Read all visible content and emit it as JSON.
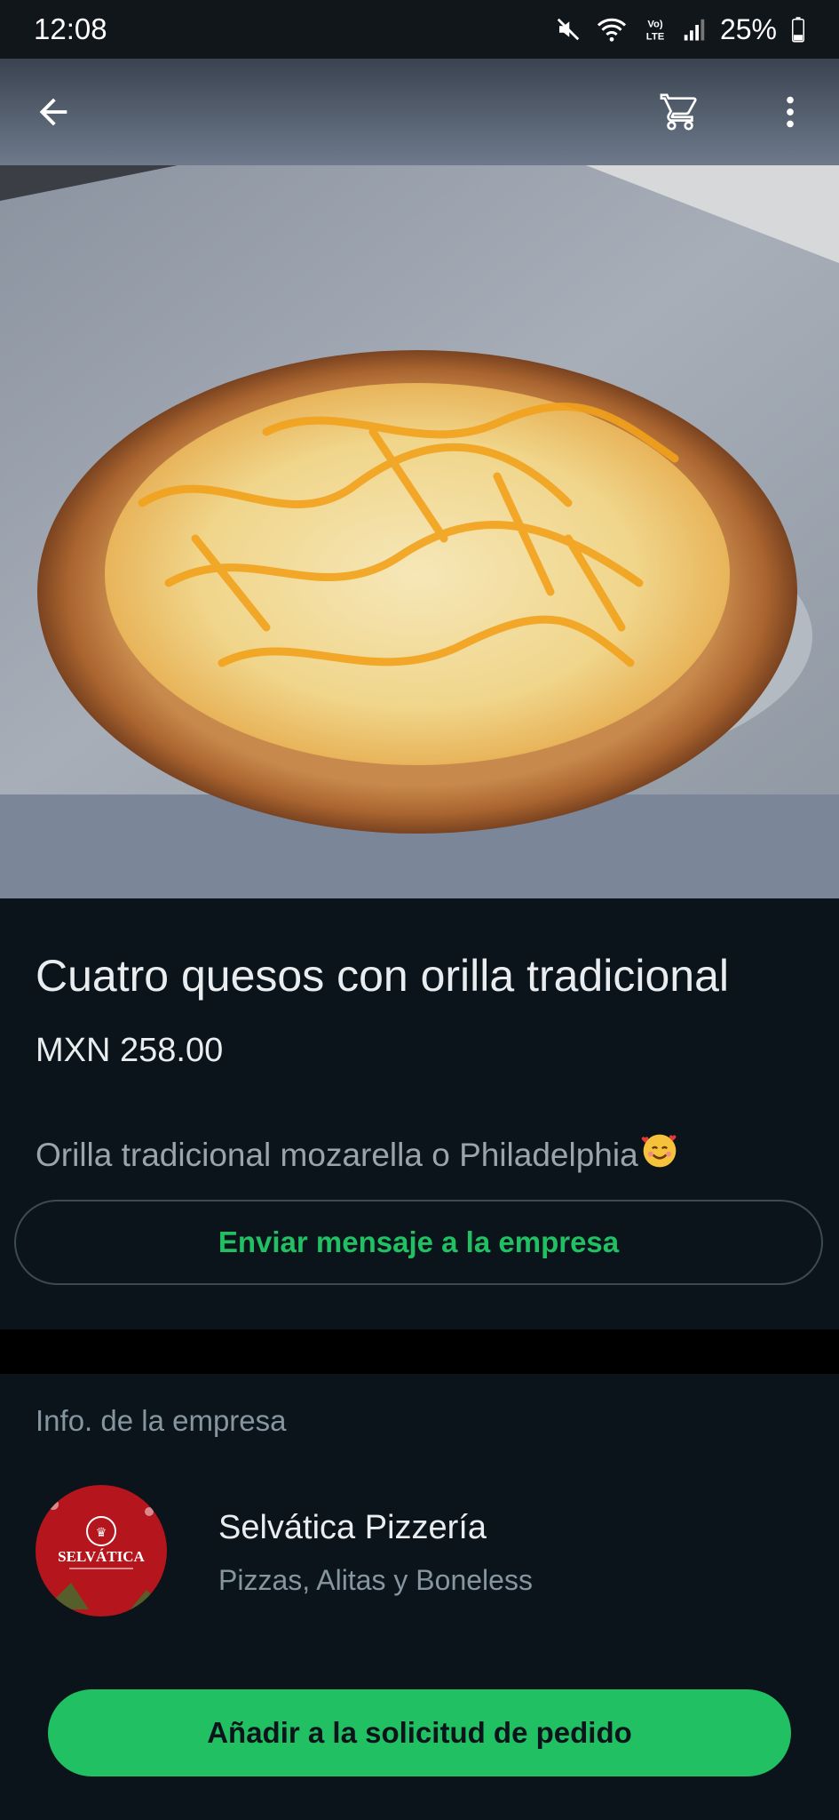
{
  "status_bar": {
    "time": "12:08",
    "battery": "25%",
    "icons": [
      "mute-icon",
      "wifi-icon",
      "volte-icon",
      "signal-icon",
      "battery-icon"
    ]
  },
  "app_bar": {
    "icons": [
      "back-arrow-icon",
      "cart-icon",
      "more-vert-icon"
    ]
  },
  "product": {
    "image": "pizza-photo",
    "title": "Cuatro quesos con orilla tradicional",
    "price": "MXN 258.00",
    "description": "Orilla tradicional mozarella o Philadelphia",
    "description_emoji": "smiling-face-with-hearts-icon",
    "message_button": "Enviar mensaje a la empresa"
  },
  "business": {
    "section_title": "Info. de la empresa",
    "name": "Selvática Pizzería",
    "category": "Pizzas, Alitas y Boneless",
    "avatar_logo_text": "SELVÁTICA"
  },
  "actions": {
    "add_to_order": "Añadir a la solicitud de pedido"
  },
  "colors": {
    "accent_green": "#21c063",
    "background": "#0b141a",
    "secondary_text": "#8696a0"
  }
}
